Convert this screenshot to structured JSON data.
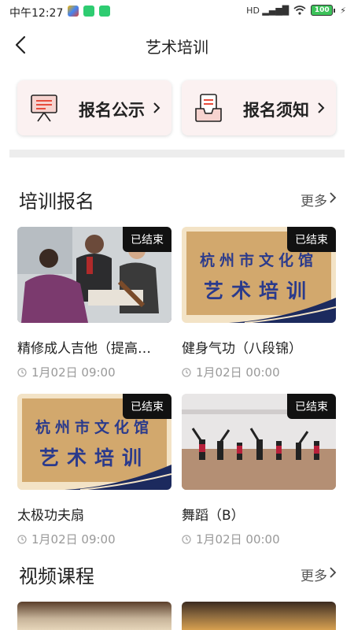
{
  "status_bar": {
    "time": "中午12:27",
    "signal": "HD",
    "battery": "100"
  },
  "header": {
    "title": "艺术培训"
  },
  "quick_links": [
    {
      "label": "报名公示",
      "icon": "easel-icon"
    },
    {
      "label": "报名须知",
      "icon": "document-tray-icon"
    }
  ],
  "sections": {
    "training": {
      "title": "培训报名",
      "more": "更多"
    },
    "video": {
      "title": "视频课程",
      "more": "更多"
    }
  },
  "cards": [
    {
      "title": "精修成人吉他（提高…",
      "time": "1月02日 09:00",
      "badge": "已结束"
    },
    {
      "title": "健身气功（八段锦）",
      "time": "1月02日 00:00",
      "badge": "已结束"
    },
    {
      "title": "太极功夫扇",
      "time": "1月02日 09:00",
      "badge": "已结束"
    },
    {
      "title": "舞蹈（B）",
      "time": "1月02日 00:00",
      "badge": "已结束"
    }
  ],
  "banner_text": {
    "line1": "杭州市文化馆",
    "line2": "艺术培训"
  },
  "colors": {
    "badge_bg": "#111111",
    "card_bg": "#fbf1f1",
    "accent_red": "#e74c3c",
    "banner_text": "#2a3a8c"
  }
}
